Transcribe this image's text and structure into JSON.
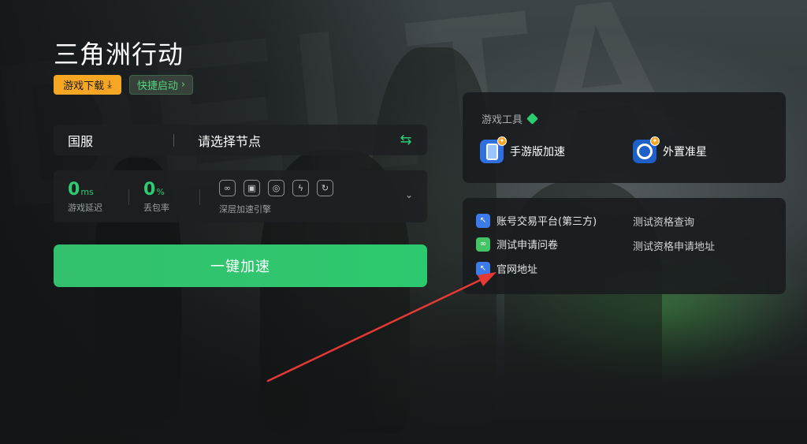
{
  "game": {
    "title": "三角洲行动",
    "download_label": "游戏下载",
    "quick_start_label": "快捷启动"
  },
  "server": {
    "region": "国服",
    "node_placeholder": "请选择节点"
  },
  "stats": {
    "latency_value": "0",
    "latency_unit": "ms",
    "latency_label": "游戏延迟",
    "loss_value": "0",
    "loss_unit": "%",
    "loss_label": "丢包率",
    "engine_label": "深层加速引擎",
    "engine_icons": [
      "link-icon",
      "image-icon",
      "loop-icon",
      "bolt-icon",
      "refresh-icon"
    ]
  },
  "boost_button_label": "一键加速",
  "tools": {
    "title": "游戏工具",
    "items": [
      {
        "label": "手游版加速",
        "icon": "phone-icon"
      },
      {
        "label": "外置准星",
        "icon": "crosshair-icon"
      }
    ]
  },
  "links": {
    "items": [
      {
        "label": "账号交易平台(第三方)",
        "icon": "cursor-icon"
      },
      {
        "label": "测试申请问卷",
        "icon": "link-icon"
      },
      {
        "label": "官网地址",
        "icon": "cursor-icon"
      }
    ],
    "plain": [
      "测试资格查询",
      "测试资格申请地址"
    ]
  },
  "colors": {
    "accent_green": "#2ecc71",
    "download_orange": "#f5a623",
    "annotation_red": "#e53935"
  }
}
